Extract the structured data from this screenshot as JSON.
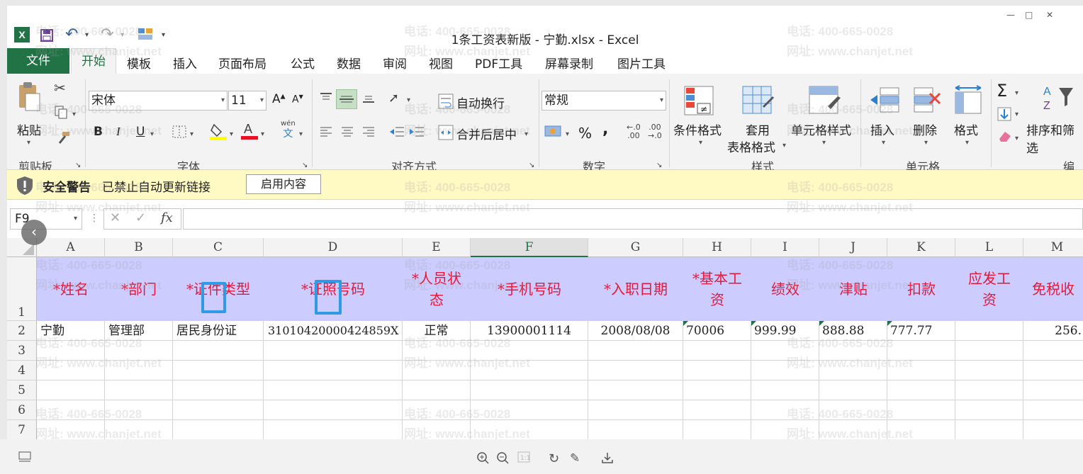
{
  "app": {
    "title": "1条工资表新版 - 宁勤.xlsx - Excel"
  },
  "menu": {
    "file": "文件",
    "home": "开始",
    "items": [
      "模板",
      "插入",
      "页面布局",
      "公式",
      "数据",
      "审阅",
      "视图",
      "PDF工具",
      "屏幕录制",
      "图片工具"
    ]
  },
  "ribbon": {
    "clipboard": {
      "paste": "粘贴",
      "group": "剪贴板"
    },
    "font": {
      "name": "宋体",
      "size": "11",
      "group": "字体",
      "bold": "B",
      "italic": "I",
      "underline": "U",
      "grow": "A",
      "shrink": "A",
      "phonetic": "wén",
      "phonetic_char": "文"
    },
    "align": {
      "wrap": "自动换行",
      "merge": "合并后居中",
      "group": "对齐方式"
    },
    "number": {
      "format": "常规",
      "percent": "%",
      "comma": ",",
      "group": "数字"
    },
    "styles": {
      "conditional": "条件格式",
      "table_line1": "套用",
      "table_line2": "表格格式",
      "cell_styles": "单元格样式",
      "group": "样式"
    },
    "cells": {
      "insert": "插入",
      "delete": "删除",
      "format": "格式",
      "group": "单元格"
    },
    "editing": {
      "sort": "排序和筛选",
      "group": "编辑",
      "sum": "Σ"
    }
  },
  "security": {
    "title": "安全警告",
    "message": "已禁止自动更新链接",
    "button": "启用内容"
  },
  "formula": {
    "namebox": "F9",
    "fx": "fx"
  },
  "sheet": {
    "columns": [
      "A",
      "B",
      "C",
      "D",
      "E",
      "F",
      "G",
      "H",
      "I",
      "J",
      "K",
      "L",
      "M"
    ],
    "selected_column": "F",
    "rows": [
      "1",
      "2",
      "3",
      "4",
      "5",
      "6",
      "7"
    ],
    "headers": [
      "*姓名",
      "*部门",
      "*证件类型",
      "*证照号码",
      "*人员状态",
      "*手机号码",
      "*入职日期",
      "*基本工资",
      "绩效",
      "津贴",
      "扣款",
      "应发工资",
      "免税收"
    ],
    "row2": [
      "宁勤",
      "管理部",
      "居民身份证",
      "310104200004248​59X",
      "正常",
      "13900001114",
      "2008/08/08",
      "70006",
      "999.99",
      "888.88",
      "777.77",
      "",
      "256."
    ]
  },
  "watermark": {
    "phone": "电话: 400-665-0028",
    "site": "网址: www.chanjet.net"
  },
  "colors": {
    "excel_green": "#217346",
    "header_fill": "#ccccff",
    "header_text": "#e8173a",
    "highlight_box": "#2e9be6",
    "security_bar": "#fff9c4"
  }
}
